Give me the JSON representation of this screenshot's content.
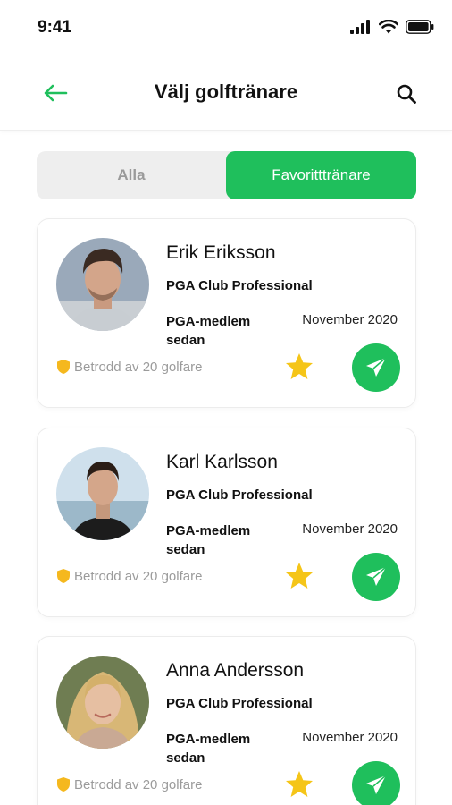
{
  "status_bar": {
    "time": "9:41"
  },
  "header": {
    "title": "Välj golftränare",
    "back_icon": "arrow-left-icon",
    "search_icon": "search-icon"
  },
  "tabs": [
    {
      "label": "Alla",
      "active": false
    },
    {
      "label": "Favoritttränare",
      "active": true
    }
  ],
  "coaches": [
    {
      "name": "Erik Eriksson",
      "title": "PGA Club Professional",
      "member_label": "PGA-medlem sedan",
      "member_since": "November 2020",
      "trusted": "Betrodd av 20 golfare",
      "favorite": true
    },
    {
      "name": "Karl Karlsson",
      "title": "PGA Club Professional",
      "member_label": "PGA-medlem sedan",
      "member_since": "November 2020",
      "trusted": "Betrodd av 20 golfare",
      "favorite": true
    },
    {
      "name": "Anna Andersson",
      "title": "PGA Club Professional",
      "member_label": "PGA-medlem sedan",
      "member_since": "November 2020",
      "trusted": "Betrodd av 20 golfare",
      "favorite": true
    }
  ],
  "colors": {
    "accent": "#1fbf5c",
    "star": "#f5c518",
    "shield": "#f5b81e",
    "muted": "#9b9b9b"
  }
}
